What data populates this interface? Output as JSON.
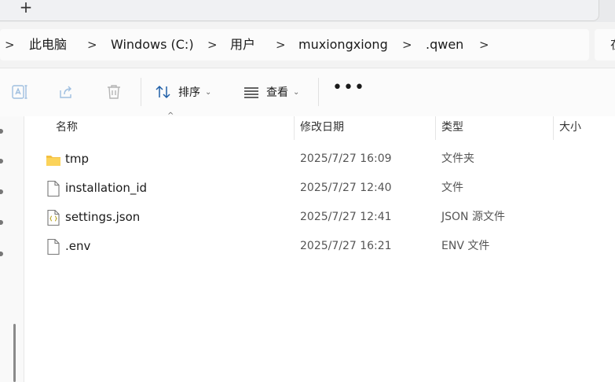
{
  "tab_strip": {
    "new_tab_glyph": "+"
  },
  "breadcrumb": {
    "separator": ">",
    "items": [
      "此电脑",
      "Windows (C:)",
      "用户",
      "muxiongxiong",
      ".qwen"
    ],
    "search_partial": "在"
  },
  "toolbar": {
    "sort_label": "排序",
    "view_label": "查看",
    "more_glyph": "•••",
    "icons": [
      "rename-icon",
      "share-icon",
      "delete-icon",
      "sort-icon",
      "view-icon",
      "more-icon"
    ]
  },
  "columns": {
    "name": "名称",
    "date": "修改日期",
    "type": "类型",
    "size": "大小"
  },
  "files": [
    {
      "name": "tmp",
      "date": "2025/7/27 16:09",
      "type": "文件夹",
      "icon": "folder-icon"
    },
    {
      "name": "installation_id",
      "date": "2025/7/27 12:40",
      "type": "文件",
      "icon": "file-icon"
    },
    {
      "name": "settings.json",
      "date": "2025/7/27 12:41",
      "type": "JSON 源文件",
      "icon": "json-file-icon"
    },
    {
      "name": ".env",
      "date": "2025/7/27 16:21",
      "type": "ENV 文件",
      "icon": "file-icon"
    }
  ],
  "colors": {
    "folder": "#f4c041",
    "background": "#f3f3f3",
    "content_bg": "#ffffff"
  }
}
